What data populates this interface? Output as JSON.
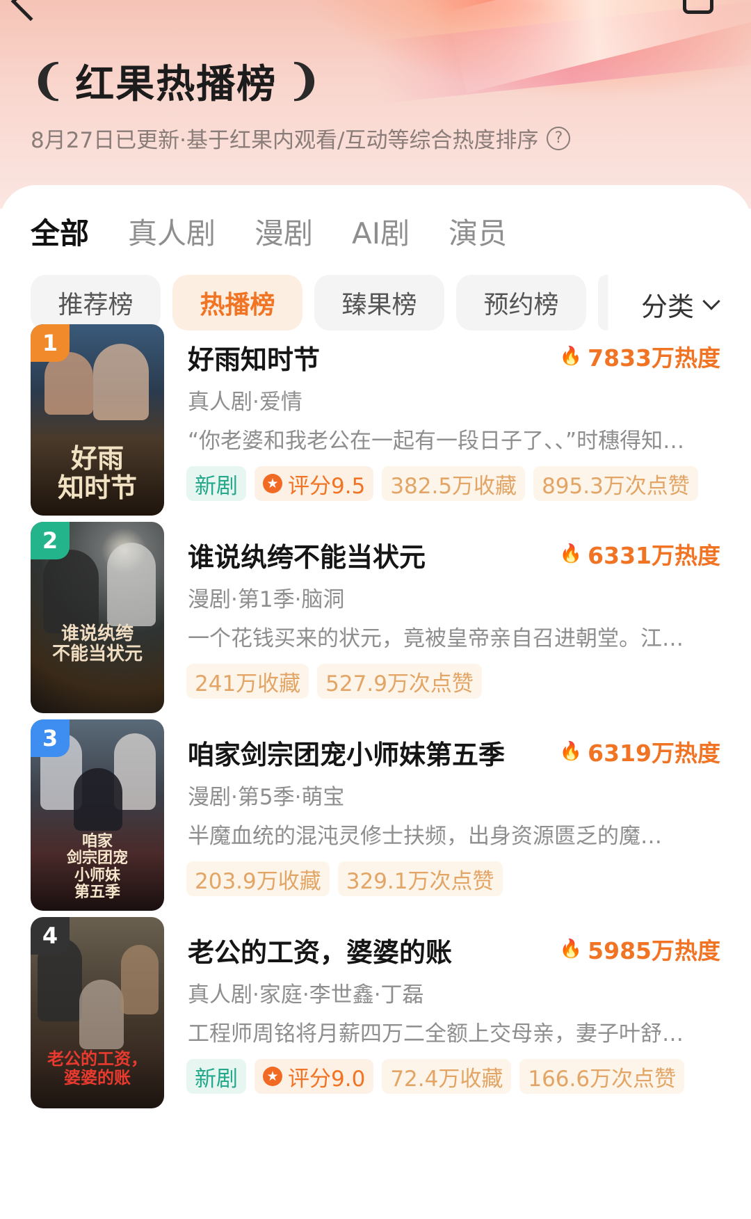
{
  "header": {
    "title": "红果热播榜",
    "laurel_left": "❨",
    "laurel_right": "❩",
    "subtitle": "8月27日已更新·基于红果内观看/互动等综合热度排序",
    "help_glyph": "?"
  },
  "tabs": [
    "全部",
    "真人剧",
    "漫剧",
    "AI剧",
    "演员"
  ],
  "chips": [
    "推荐榜",
    "热播榜",
    "臻果榜",
    "预约榜"
  ],
  "category_label": "分类",
  "colors": {
    "accent": "#f07424",
    "new_tag": "#23a88a",
    "rank1": "#f08a2a",
    "rank2": "#23b48c",
    "rank3": "#3d8ef0",
    "rank4": "#333333"
  },
  "items": [
    {
      "rank": "1",
      "title": "好雨知时节",
      "heat": "7833万热度",
      "meta": "真人剧·爱情",
      "desc": "“你老婆和我老公在一起有一段日子了、、”时穗得知…",
      "poster_text": "好雨\n知时节",
      "tags": [
        {
          "kind": "new",
          "text": "新剧"
        },
        {
          "kind": "score",
          "text": "评分9.5"
        },
        {
          "kind": "stat",
          "text": "382.5万收藏"
        },
        {
          "kind": "stat",
          "text": "895.3万次点赞"
        }
      ]
    },
    {
      "rank": "2",
      "title": "谁说纨绔不能当状元",
      "heat": "6331万热度",
      "meta": "漫剧·第1季·脑洞",
      "desc": "一个花钱买来的状元，竟被皇帝亲自召进朝堂。江…",
      "poster_text": "谁说纨绔\n不能当状元",
      "tags": [
        {
          "kind": "stat",
          "text": "241万收藏"
        },
        {
          "kind": "stat",
          "text": "527.9万次点赞"
        }
      ]
    },
    {
      "rank": "3",
      "title": "咱家剑宗团宠小师妹第五季",
      "heat": "6319万热度",
      "meta": "漫剧·第5季·萌宝",
      "desc": "半魔血统的混沌灵修士扶频，出身资源匮乏的魔…",
      "poster_text": "咱家\n剑宗团宠\n小师妹\n第五季",
      "tags": [
        {
          "kind": "stat",
          "text": "203.9万收藏"
        },
        {
          "kind": "stat",
          "text": "329.1万次点赞"
        }
      ]
    },
    {
      "rank": "4",
      "title": "老公的工资，婆婆的账",
      "heat": "5985万热度",
      "meta": "真人剧·家庭·李世鑫·丁磊",
      "desc": "工程师周铭将月薪四万二全额上交母亲，妻子叶舒…",
      "poster_text": "老公的工资，\n婆婆的账",
      "tags": [
        {
          "kind": "new",
          "text": "新剧"
        },
        {
          "kind": "score",
          "text": "评分9.0"
        },
        {
          "kind": "stat",
          "text": "72.4万收藏"
        },
        {
          "kind": "stat",
          "text": "166.6万次点赞"
        }
      ]
    }
  ]
}
